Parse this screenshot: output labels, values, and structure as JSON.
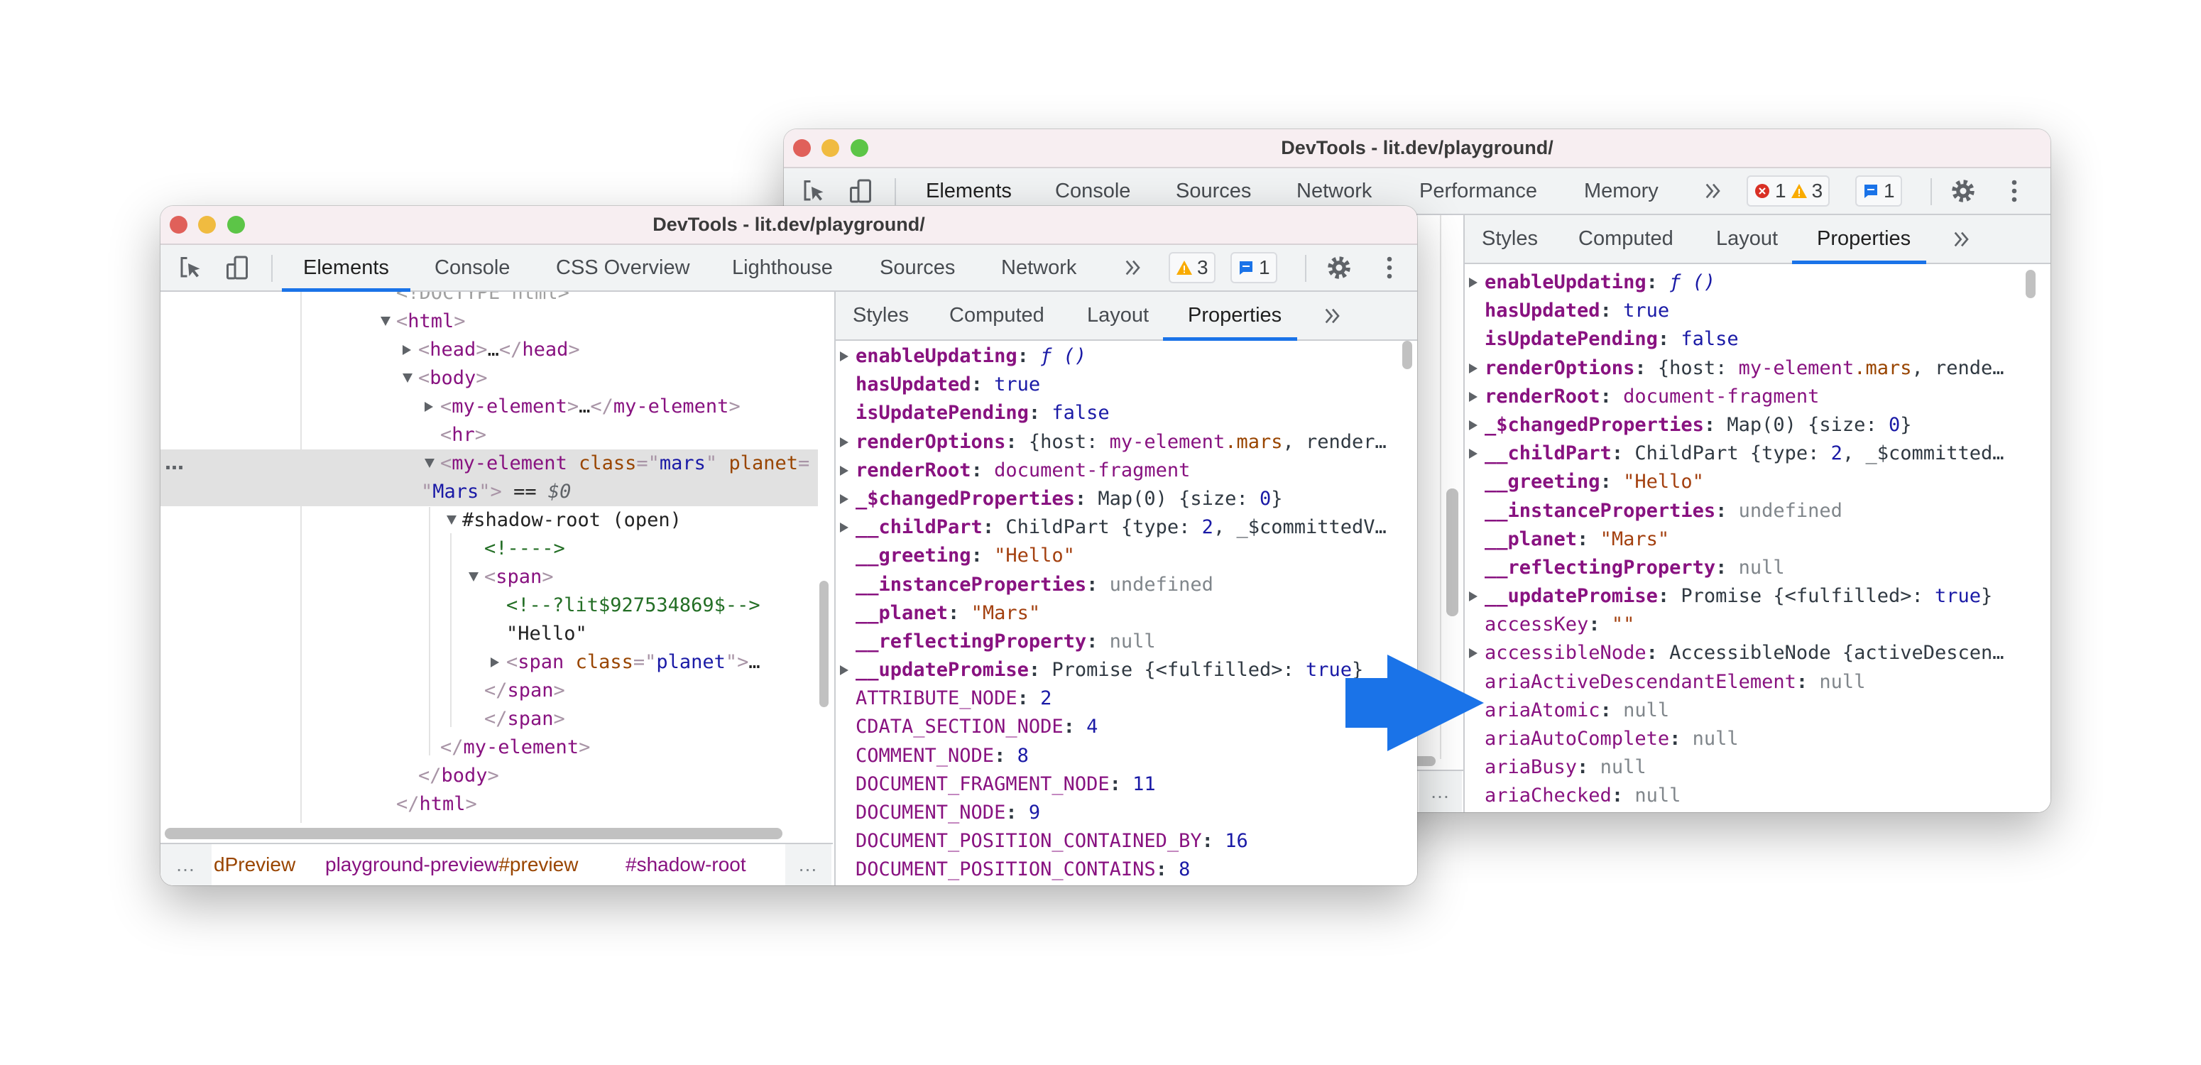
{
  "colors": {
    "accent": "#1a73e8",
    "arrow": "#1a73e8",
    "warning": "#f9ab00",
    "error": "#d93025",
    "title_bar": "#f7eef1",
    "close": "#e0605a",
    "minimize": "#f0bb40",
    "maximize": "#5cc547"
  },
  "back": {
    "title": "DevTools - lit.dev/playground/",
    "tabs": [
      "Elements",
      "Console",
      "Sources",
      "Network",
      "Performance",
      "Memory"
    ],
    "active_tab": "Elements",
    "issues": [
      {
        "icon": "error-icon",
        "count": "1"
      },
      {
        "icon": "warning-icon",
        "count": "3"
      }
    ],
    "messages": {
      "icon": "message-icon",
      "count": "1"
    },
    "sidebar_tabs": [
      "Styles",
      "Computed",
      "Layout",
      "Properties"
    ],
    "active_sidebar_tab": "Properties",
    "ellipsis": "…",
    "properties": [
      {
        "key": "enableUpdating",
        "own": true,
        "expandable": true,
        "segs": [
          [
            "fn",
            "ƒ"
          ],
          [
            "fn",
            " ()"
          ]
        ]
      },
      {
        "key": "hasUpdated",
        "own": true,
        "segs": [
          [
            "num",
            "true"
          ]
        ]
      },
      {
        "key": "isUpdatePending",
        "own": true,
        "segs": [
          [
            "num",
            "false"
          ]
        ]
      },
      {
        "key": "renderOptions",
        "own": true,
        "expandable": true,
        "segs": [
          [
            "obj",
            "{host: "
          ],
          [
            "tag",
            "my-element"
          ],
          [
            "attr",
            ".mars"
          ],
          [
            "obj",
            ", rende…"
          ]
        ]
      },
      {
        "key": "renderRoot",
        "own": true,
        "expandable": true,
        "segs": [
          [
            "tag",
            "document-fragment"
          ]
        ]
      },
      {
        "key": "_$changedProperties",
        "own": true,
        "expandable": true,
        "segs": [
          [
            "obj",
            "Map(0) {size: "
          ],
          [
            "num",
            "0"
          ],
          [
            "obj",
            "}"
          ]
        ]
      },
      {
        "key": "__childPart",
        "own": true,
        "expandable": true,
        "segs": [
          [
            "obj",
            "ChildPart {type: "
          ],
          [
            "num",
            "2"
          ],
          [
            "obj",
            ", _$committed…"
          ]
        ]
      },
      {
        "key": "__greeting",
        "own": true,
        "segs": [
          [
            "str",
            "\"Hello\""
          ]
        ]
      },
      {
        "key": "__instanceProperties",
        "own": true,
        "segs": [
          [
            "null",
            "undefined"
          ]
        ]
      },
      {
        "key": "__planet",
        "own": true,
        "segs": [
          [
            "str",
            "\"Mars\""
          ]
        ]
      },
      {
        "key": "__reflectingProperty",
        "own": true,
        "segs": [
          [
            "null",
            "null"
          ]
        ]
      },
      {
        "key": "__updatePromise",
        "own": true,
        "expandable": true,
        "segs": [
          [
            "obj",
            "Promise {<fulfilled>: "
          ],
          [
            "num",
            "true"
          ],
          [
            "obj",
            "}"
          ]
        ]
      },
      {
        "key": "accessKey",
        "own": false,
        "segs": [
          [
            "str",
            "\"\""
          ]
        ]
      },
      {
        "key": "accessibleNode",
        "own": false,
        "expandable": true,
        "segs": [
          [
            "obj",
            "AccessibleNode {activeDescen…"
          ]
        ]
      },
      {
        "key": "ariaActiveDescendantElement",
        "own": false,
        "segs": [
          [
            "null",
            "null"
          ]
        ]
      },
      {
        "key": "ariaAtomic",
        "own": false,
        "segs": [
          [
            "null",
            "null"
          ]
        ]
      },
      {
        "key": "ariaAutoComplete",
        "own": false,
        "segs": [
          [
            "null",
            "null"
          ]
        ]
      },
      {
        "key": "ariaBusy",
        "own": false,
        "segs": [
          [
            "null",
            "null"
          ]
        ]
      },
      {
        "key": "ariaChecked",
        "own": false,
        "segs": [
          [
            "null",
            "null"
          ]
        ]
      }
    ]
  },
  "front": {
    "title": "DevTools - lit.dev/playground/",
    "tabs": [
      "Elements",
      "Console",
      "CSS Overview",
      "Lighthouse",
      "Sources",
      "Network"
    ],
    "active_tab": "Elements",
    "issues": [
      {
        "icon": "warning-icon",
        "count": "3"
      }
    ],
    "messages": {
      "icon": "message-icon",
      "count": "1"
    },
    "sidebar_tabs": [
      "Styles",
      "Computed",
      "Layout",
      "Properties"
    ],
    "active_sidebar_tab": "Properties",
    "ellipsis": "…",
    "row_marker": "…",
    "tree": [
      {
        "depth": 0,
        "segs": [
          [
            "gray",
            "<!DOCTYPE html>"
          ]
        ]
      },
      {
        "depth": 0,
        "arrow": "down",
        "segs": [
          [
            "br",
            "<"
          ],
          [
            "tag",
            "html"
          ],
          [
            "br",
            ">"
          ]
        ]
      },
      {
        "depth": 1,
        "arrow": "right",
        "segs": [
          [
            "br",
            "<"
          ],
          [
            "tag",
            "head"
          ],
          [
            "br",
            ">"
          ],
          [
            "text",
            "…"
          ],
          [
            "br",
            "</"
          ],
          [
            "tag",
            "head"
          ],
          [
            "br",
            ">"
          ]
        ]
      },
      {
        "depth": 1,
        "arrow": "down",
        "segs": [
          [
            "br",
            "<"
          ],
          [
            "tag",
            "body"
          ],
          [
            "br",
            ">"
          ]
        ]
      },
      {
        "depth": 2,
        "arrow": "right",
        "segs": [
          [
            "br",
            "<"
          ],
          [
            "tag",
            "my-element"
          ],
          [
            "br",
            ">"
          ],
          [
            "text",
            "…"
          ],
          [
            "br",
            "</"
          ],
          [
            "tag",
            "my-element"
          ],
          [
            "br",
            ">"
          ]
        ]
      },
      {
        "depth": 2,
        "segs": [
          [
            "br",
            "<"
          ],
          [
            "tag",
            "hr"
          ],
          [
            "br",
            ">"
          ]
        ]
      },
      {
        "depth": 2,
        "arrow": "down",
        "selected": true,
        "segs": [
          [
            "br",
            "<"
          ],
          [
            "tag",
            "my-element"
          ],
          [
            "sp",
            " "
          ],
          [
            "attr",
            "class"
          ],
          [
            "br",
            "=\""
          ],
          [
            "val",
            "mars"
          ],
          [
            "br",
            "\""
          ],
          [
            "sp",
            " "
          ],
          [
            "attr",
            "planet"
          ],
          [
            "br",
            "="
          ]
        ],
        "wrap": [
          [
            "br",
            "\""
          ],
          [
            "val",
            "Mars"
          ],
          [
            "br",
            "\">"
          ],
          [
            "text",
            " == "
          ],
          [
            "dollar",
            "$0"
          ]
        ]
      },
      {
        "depth": 3,
        "arrow": "down",
        "segs": [
          [
            "text",
            "#shadow-root (open)"
          ]
        ]
      },
      {
        "depth": 4,
        "segs": [
          [
            "comment",
            "<!---->"
          ]
        ]
      },
      {
        "depth": 4,
        "arrow": "down",
        "segs": [
          [
            "br",
            "<"
          ],
          [
            "tag",
            "span"
          ],
          [
            "br",
            ">"
          ]
        ]
      },
      {
        "depth": 5,
        "segs": [
          [
            "comment",
            "<!--?lit$927534869$-->"
          ]
        ]
      },
      {
        "depth": 5,
        "segs": [
          [
            "text",
            "\"Hello\""
          ]
        ]
      },
      {
        "depth": 5,
        "arrow": "right",
        "segs": [
          [
            "br",
            "<"
          ],
          [
            "tag",
            "span"
          ],
          [
            "sp",
            " "
          ],
          [
            "attr",
            "class"
          ],
          [
            "br",
            "=\""
          ],
          [
            "val",
            "planet"
          ],
          [
            "br",
            "\">"
          ],
          [
            "text",
            "…"
          ]
        ]
      },
      {
        "depth": 4,
        "segs": [
          [
            "br",
            "</"
          ],
          [
            "tag",
            "span"
          ],
          [
            "br",
            ">"
          ]
        ]
      },
      {
        "depth": 4,
        "segs": [
          [
            "br",
            "</"
          ],
          [
            "tag",
            "span"
          ],
          [
            "br",
            ">"
          ]
        ]
      },
      {
        "depth": 2,
        "segs": [
          [
            "br",
            "</"
          ],
          [
            "tag",
            "my-element"
          ],
          [
            "br",
            ">"
          ]
        ]
      },
      {
        "depth": 1,
        "segs": [
          [
            "br",
            "</"
          ],
          [
            "tag",
            "body"
          ],
          [
            "br",
            ">"
          ]
        ]
      },
      {
        "depth": 0,
        "segs": [
          [
            "br",
            "</"
          ],
          [
            "tag",
            "html"
          ],
          [
            "br",
            ">"
          ]
        ]
      }
    ],
    "breadcrumbs": [
      {
        "segs": [
          [
            "attr",
            "dPreview"
          ]
        ]
      },
      {
        "segs": [
          [
            "tag",
            "playground-preview"
          ],
          [
            "attr",
            "#preview"
          ]
        ]
      },
      {
        "segs": [
          [
            "tag",
            "#shadow-root"
          ]
        ]
      }
    ],
    "properties": [
      {
        "key": "enableUpdating",
        "own": true,
        "expandable": true,
        "segs": [
          [
            "fn",
            "ƒ"
          ],
          [
            "fn",
            " ()"
          ]
        ]
      },
      {
        "key": "hasUpdated",
        "own": true,
        "segs": [
          [
            "num",
            "true"
          ]
        ]
      },
      {
        "key": "isUpdatePending",
        "own": true,
        "segs": [
          [
            "num",
            "false"
          ]
        ]
      },
      {
        "key": "renderOptions",
        "own": true,
        "expandable": true,
        "segs": [
          [
            "obj",
            "{host: "
          ],
          [
            "tag",
            "my-element"
          ],
          [
            "attr",
            ".mars"
          ],
          [
            "obj",
            ", render…"
          ]
        ]
      },
      {
        "key": "renderRoot",
        "own": true,
        "expandable": true,
        "segs": [
          [
            "tag",
            "document-fragment"
          ]
        ]
      },
      {
        "key": "_$changedProperties",
        "own": true,
        "expandable": true,
        "segs": [
          [
            "obj",
            "Map(0) {size: "
          ],
          [
            "num",
            "0"
          ],
          [
            "obj",
            "}"
          ]
        ]
      },
      {
        "key": "__childPart",
        "own": true,
        "expandable": true,
        "segs": [
          [
            "obj",
            "ChildPart {type: "
          ],
          [
            "num",
            "2"
          ],
          [
            "obj",
            ", _$committedV…"
          ]
        ]
      },
      {
        "key": "__greeting",
        "own": true,
        "segs": [
          [
            "str",
            "\"Hello\""
          ]
        ]
      },
      {
        "key": "__instanceProperties",
        "own": true,
        "segs": [
          [
            "null",
            "undefined"
          ]
        ]
      },
      {
        "key": "__planet",
        "own": true,
        "segs": [
          [
            "str",
            "\"Mars\""
          ]
        ]
      },
      {
        "key": "__reflectingProperty",
        "own": true,
        "segs": [
          [
            "null",
            "null"
          ]
        ]
      },
      {
        "key": "__updatePromise",
        "own": true,
        "expandable": true,
        "segs": [
          [
            "obj",
            "Promise {<fulfilled>: "
          ],
          [
            "num",
            "true"
          ],
          [
            "obj",
            "}"
          ]
        ]
      },
      {
        "key": "ATTRIBUTE_NODE",
        "own": false,
        "segs": [
          [
            "num",
            "2"
          ]
        ]
      },
      {
        "key": "CDATA_SECTION_NODE",
        "own": false,
        "segs": [
          [
            "num",
            "4"
          ]
        ]
      },
      {
        "key": "COMMENT_NODE",
        "own": false,
        "segs": [
          [
            "num",
            "8"
          ]
        ]
      },
      {
        "key": "DOCUMENT_FRAGMENT_NODE",
        "own": false,
        "segs": [
          [
            "num",
            "11"
          ]
        ]
      },
      {
        "key": "DOCUMENT_NODE",
        "own": false,
        "segs": [
          [
            "num",
            "9"
          ]
        ]
      },
      {
        "key": "DOCUMENT_POSITION_CONTAINED_BY",
        "own": false,
        "segs": [
          [
            "num",
            "16"
          ]
        ]
      },
      {
        "key": "DOCUMENT_POSITION_CONTAINS",
        "own": false,
        "segs": [
          [
            "num",
            "8"
          ]
        ]
      }
    ]
  }
}
